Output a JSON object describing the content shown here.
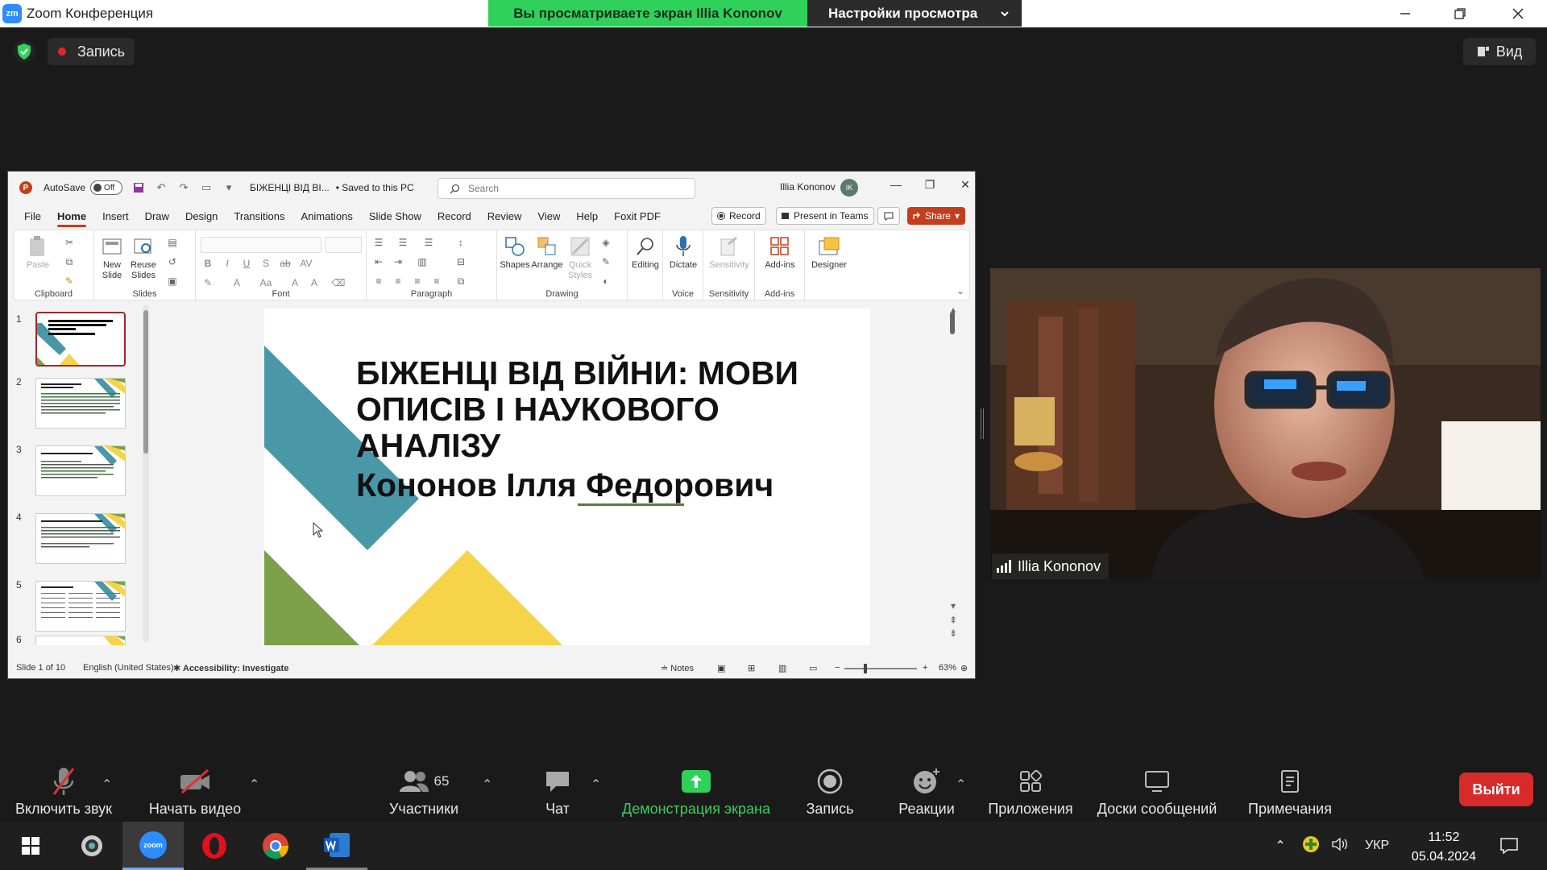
{
  "zoom": {
    "window_title": "Zoom Конференция",
    "logo_text": "zm",
    "banner_viewing": "Вы просматриваете экран Illia Kononov",
    "banner_view_options": "Настройки просмотра",
    "recording_label": "Запись",
    "view_label": "Вид",
    "colors": {
      "banner_green": "#2fd15a",
      "leave_red": "#d92a2a",
      "record_red": "#e02828"
    }
  },
  "ppt": {
    "logo_text": "P",
    "autosave_label": "AutoSave",
    "autosave_state": "Off",
    "doc_name": "БІЖЕНЦІ ВІД ВІ...",
    "saved_label": "• Saved to this PC",
    "search_placeholder": "Search",
    "user_name": "Illia Kononov",
    "user_initials": "IK",
    "menu_tabs": [
      "File",
      "Home",
      "Insert",
      "Draw",
      "Design",
      "Transitions",
      "Animations",
      "Slide Show",
      "Record",
      "Review",
      "View",
      "Help",
      "Foxit PDF"
    ],
    "record_btn": "Record",
    "present_btn": "Present in Teams",
    "share_btn": "Share",
    "ribbon": {
      "paste": "Paste",
      "new_slide": "New Slide",
      "reuse_slides": "Reuse Slides",
      "shapes": "Shapes",
      "arrange": "Arrange",
      "quick_styles": "Quick Styles",
      "editing": "Editing",
      "dictate": "Dictate",
      "sensitivity": "Sensitivity",
      "addins": "Add-ins",
      "designer": "Designer",
      "groups": {
        "clipboard": "Clipboard",
        "slides": "Slides",
        "font": "Font",
        "paragraph": "Paragraph",
        "drawing": "Drawing",
        "voice": "Voice",
        "sensitivity": "Sensitivity",
        "addins": "Add-ins"
      }
    },
    "slide_numbers": [
      "1",
      "2",
      "3",
      "4",
      "5",
      "6"
    ],
    "slide": {
      "title": "БІЖЕНЦІ ВІД ВІЙНИ: МОВИ ОПИСІВ І НАУКОВОГО АНАЛІЗУ",
      "subtitle": "Кононов Ілля Федорович",
      "colors": {
        "teal": "#4a97a7",
        "green": "#7ca04a",
        "yellow": "#f5d44a"
      }
    },
    "status": {
      "slide_of": "Slide 1 of 10",
      "language": "English (United States)",
      "accessibility": "Accessibility: Investigate",
      "notes": "Notes",
      "zoom_level": "63%"
    }
  },
  "cam": {
    "participant_name": "Illia Kononov"
  },
  "toolbar": {
    "unmute": "Включить звук",
    "start_video": "Начать видео",
    "participants": "Участники",
    "participants_count": "65",
    "chat": "Чат",
    "share_screen": "Демонстрация экрана",
    "record": "Запись",
    "reactions": "Реакции",
    "apps": "Приложения",
    "whiteboards": "Доски сообщений",
    "notes": "Примечания",
    "leave": "Выйти"
  },
  "taskbar": {
    "zoom_app_label": "zoom",
    "language": "УКР",
    "time": "11:52",
    "date": "05.04.2024"
  }
}
